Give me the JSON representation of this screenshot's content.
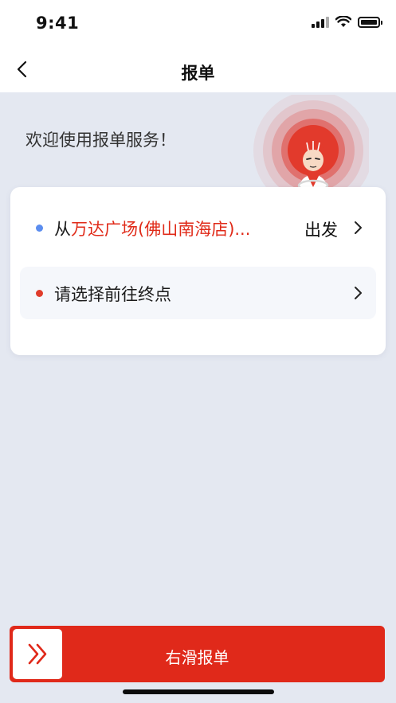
{
  "status_bar": {
    "time": "9:41",
    "icons": [
      "cellular-signal-icon",
      "wifi-icon",
      "battery-icon"
    ]
  },
  "nav": {
    "title": "报单",
    "back_icon": "chevron-left-icon"
  },
  "welcome_text": "欢迎使用报单服务！",
  "route_card": {
    "start": {
      "prefix": "从",
      "location": "万达广场(佛山南海店)...",
      "action": "出发"
    },
    "end": {
      "placeholder": "请选择前往终点"
    }
  },
  "slider": {
    "label": "右滑报单",
    "icon": "double-chevron-right-icon"
  },
  "colors": {
    "accent_red": "#e0291a",
    "start_dot": "#5b8def",
    "end_dot": "#e03c2b",
    "background": "#e4e8f1"
  }
}
